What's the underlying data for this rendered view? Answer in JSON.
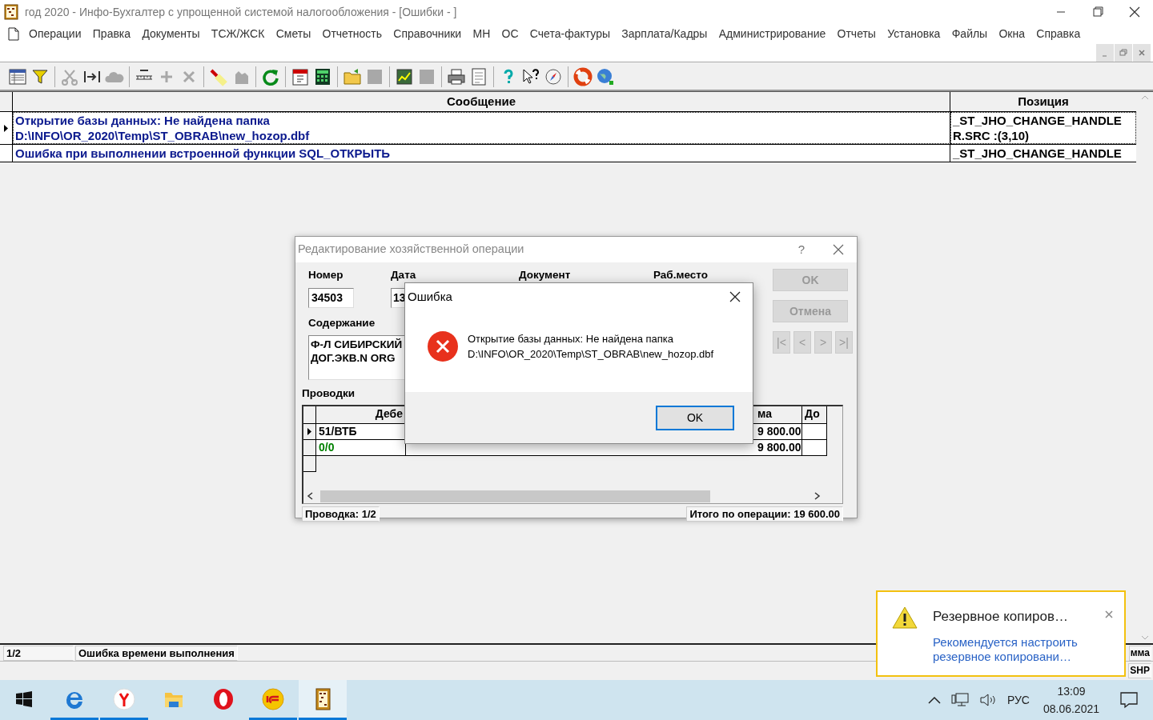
{
  "window": {
    "title": "год 2020 - Инфо-Бухгалтер с упрощенной системой налогообложения - [Ошибки - ]"
  },
  "menu": [
    "Операции",
    "Правка",
    "Документы",
    "ТСЖ/ЖСК",
    "Сметы",
    "Отчетность",
    "Справочники",
    "МН",
    "ОС",
    "Счета-фактуры",
    "Зарплата/Кадры",
    "Администрирование",
    "Отчеты",
    "Установка",
    "Файлы",
    "Окна",
    "Справка"
  ],
  "grid": {
    "columns": [
      "Сообщение",
      "Позиция"
    ],
    "rows": [
      {
        "message_lines": [
          "Открытие базы данных: Не найдена папка",
          "D:\\INFO\\OR_2020\\Temp\\ST_OBRAB\\new_hozop.dbf"
        ],
        "position_lines": [
          "_ST_JHO_CHANGE_HANDLE",
          "R.SRC :(3,10)"
        ],
        "selected": true
      },
      {
        "message_lines": [
          "Ошибка при выполнении встроенной функции SQL_ОТКРЫТЬ"
        ],
        "position_lines": [
          "_ST_JHO_CHANGE_HANDLE"
        ],
        "selected": false
      }
    ]
  },
  "edit_dialog": {
    "title": "Редактирование хозяйственной операции",
    "help": "?",
    "labels": [
      "Номер",
      "Дата",
      "Документ",
      "Раб.место"
    ],
    "number": "34503",
    "date": "13",
    "content_label": "Содержание",
    "content_lines": [
      "Ф-Л СИБИРСКИЙ",
      "ДОГ.ЭКВ.N ORG"
    ],
    "entries_label": "Проводки",
    "entries_columns": [
      "Дебе",
      "ма",
      "До"
    ],
    "entries": [
      {
        "debit": "51/ВТБ",
        "sum": "9 800.00",
        "selected": true,
        "color": "#000000"
      },
      {
        "debit": "0/0",
        "sum": "9 800.00",
        "selected": false,
        "color": "#008000"
      }
    ],
    "footer_left": "Проводка: 1/2",
    "footer_right": "Итого по операции: 19 600.00",
    "buttons": [
      {
        "label": "OK",
        "disabled": true
      },
      {
        "label": "Отмена",
        "disabled": true
      }
    ],
    "nav": [
      {
        "label": "|<",
        "disabled": true
      },
      {
        "label": "<",
        "disabled": true
      },
      {
        "label": ">",
        "disabled": true
      },
      {
        "label": ">|",
        "disabled": true
      }
    ]
  },
  "error_dialog": {
    "title": "Ошибка",
    "message_lines": [
      "Открытие базы данных: Не найдена папка",
      "D:\\INFO\\OR_2020\\Temp\\ST_OBRAB\\new_hozop.dbf"
    ],
    "button": "OK"
  },
  "status_bar": {
    "counter": "1/2",
    "message": "Ошибка времени выполнения",
    "right_top": "мма",
    "right_bottom": "SHP"
  },
  "notification": {
    "title": "Резервное копиров…",
    "text": "Рекомендуется настроить резервное копировани…"
  },
  "taskbar": {
    "apps": [
      {
        "running": true,
        "selected": false
      },
      {
        "running": true,
        "selected": false
      },
      {
        "running": false,
        "selected": false
      },
      {
        "running": false,
        "selected": false
      },
      {
        "running": true,
        "selected": false
      },
      {
        "running": true,
        "selected": true
      }
    ],
    "language": "РУС",
    "time": "13:09",
    "date": "08.06.2021"
  }
}
